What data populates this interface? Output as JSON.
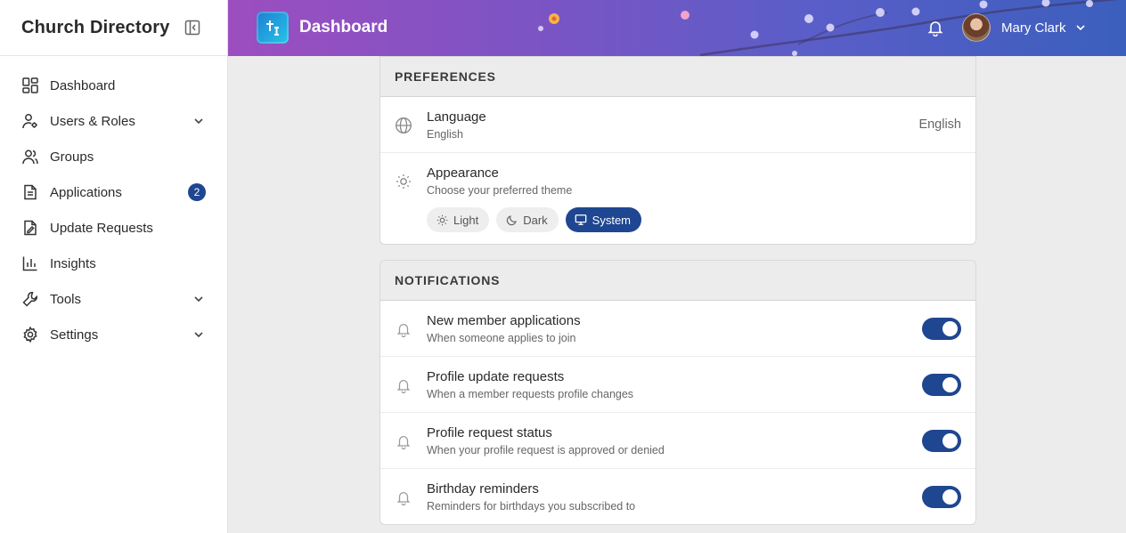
{
  "sidebar": {
    "title": "Church Directory",
    "items": [
      {
        "label": "Dashboard",
        "icon": "dashboard-icon"
      },
      {
        "label": "Users & Roles",
        "icon": "users-roles-icon"
      },
      {
        "label": "Groups",
        "icon": "groups-icon"
      },
      {
        "label": "Applications",
        "icon": "applications-icon",
        "badge": "2"
      },
      {
        "label": "Update Requests",
        "icon": "update-requests-icon"
      },
      {
        "label": "Insights",
        "icon": "insights-icon"
      },
      {
        "label": "Tools",
        "icon": "tools-icon"
      },
      {
        "label": "Settings",
        "icon": "settings-icon"
      }
    ]
  },
  "header": {
    "title": "Dashboard",
    "user_name": "Mary Clark"
  },
  "preferences": {
    "heading": "PREFERENCES",
    "language": {
      "title": "Language",
      "desc": "English",
      "value": "English"
    },
    "appearance": {
      "title": "Appearance",
      "desc": "Choose your preferred theme",
      "options": [
        "Light",
        "Dark",
        "System"
      ],
      "selected": "System"
    }
  },
  "notifications": {
    "heading": "NOTIFICATIONS",
    "items": [
      {
        "title": "New member applications",
        "desc": "When someone applies to join",
        "enabled": true
      },
      {
        "title": "Profile update requests",
        "desc": "When a member requests profile changes",
        "enabled": true
      },
      {
        "title": "Profile request status",
        "desc": "When your profile request is approved or denied",
        "enabled": true
      },
      {
        "title": "Birthday reminders",
        "desc": "Reminders for birthdays you subscribed to",
        "enabled": true
      }
    ]
  },
  "colors": {
    "accent": "#1f4690",
    "header_gradient_start": "#9c4ec0",
    "header_gradient_end": "#3b5fbd"
  }
}
